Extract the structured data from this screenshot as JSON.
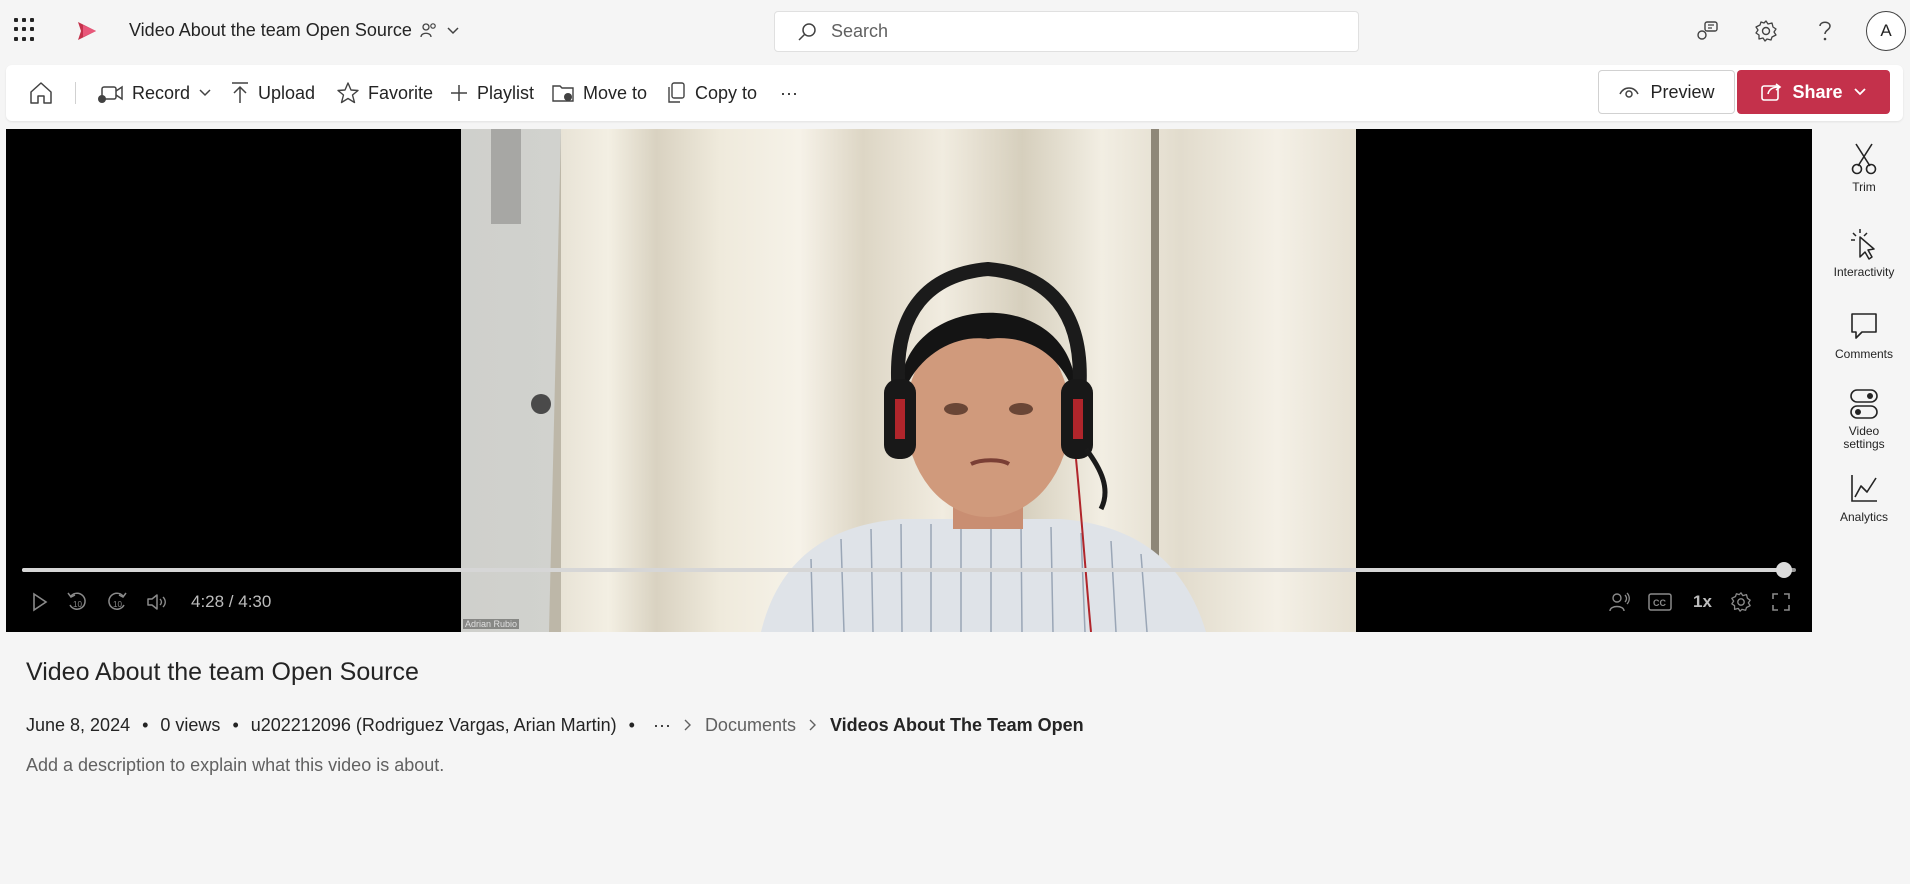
{
  "header": {
    "title": "Video About the team Open Source",
    "search_placeholder": "Search",
    "avatar_initial": "A"
  },
  "toolbar": {
    "record_label": "Record",
    "upload_label": "Upload",
    "favorite_label": "Favorite",
    "playlist_label": "Playlist",
    "move_label": "Move to",
    "copy_label": "Copy to",
    "more_label": "···",
    "preview_label": "Preview",
    "share_label": "Share"
  },
  "player": {
    "time_display": "4:28 / 4:30",
    "progress_fraction": 0.993,
    "speed_label": "1x",
    "camera_caption": "Adrian Rubio"
  },
  "side_rail": {
    "trim_label": "Trim",
    "interactivity_label": "Interactivity",
    "comments_label": "Comments",
    "video_settings_line1": "Video",
    "video_settings_line2": "settings",
    "analytics_label": "Analytics"
  },
  "video_info": {
    "title": "Video About the team Open Source",
    "date": "June 8, 2024",
    "views": "0 views",
    "owner": "u202212096 (Rodriguez Vargas, Arian Martin)",
    "breadcrumb_more": "···",
    "breadcrumb_parent": "Documents",
    "breadcrumb_current": "Videos About The Team Open",
    "description_placeholder": "Add a description to explain what this video is about."
  },
  "colors": {
    "accent": "#c4314b",
    "background": "#f5f5f5"
  },
  "icons": [
    "waffle-icon",
    "stream-logo-icon",
    "people-icon",
    "search-icon",
    "feedback-icon",
    "gear-icon",
    "help-icon",
    "home-icon",
    "camera-icon",
    "upload-icon",
    "star-icon",
    "plus-icon",
    "folder-move-icon",
    "copy-icon",
    "eye-icon",
    "share-icon",
    "play-icon",
    "rewind-10-icon",
    "forward-10-icon",
    "volume-icon",
    "noise-icon",
    "cc-icon",
    "fullscreen-icon",
    "scissors-icon",
    "cursor-click-icon",
    "comment-icon",
    "toggle-settings-icon",
    "chart-line-icon"
  ]
}
